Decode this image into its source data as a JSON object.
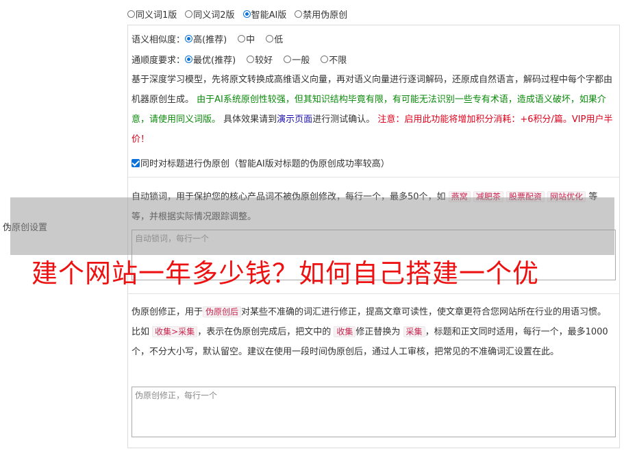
{
  "mode": {
    "options": [
      "同义词1版",
      "同义词2版",
      "智能AI版",
      "禁用伪原创"
    ],
    "selected": "智能AI版"
  },
  "side_label": "伪原创设置",
  "similarity": {
    "label": "语义相似度：",
    "options": [
      "高(推荐)",
      "中",
      "低"
    ],
    "selected": "高(推荐)"
  },
  "fluency": {
    "label": "通顺度要求：",
    "options": [
      "最优(推荐)",
      "较好",
      "一般",
      "不限"
    ],
    "selected": "最优(推荐)"
  },
  "description": {
    "normal1": "基于深度学习模型，先将原文转换成高维语义向量，再对语义向量进行逐词解码，还原成自然语言，解码过程中每个字都由机器原创生成。",
    "green": "由于AI系统原创性较强，但其知识结构毕竟有限，有可能无法识别一些专有术语，造成语义破坏，如果介意，请使用同义词版。",
    "normal2": "具体效果请到",
    "link": "演示页面",
    "normal3": "进行测试确认。",
    "red": "注意：启用此功能将增加积分消耗：+6积分/篇。VIP用户半价！"
  },
  "title_checkbox": {
    "checked": true,
    "label": "同时对标题进行伪原创（智能AI版对标题的伪原创成功率较高）"
  },
  "lock_words": {
    "text1": "自动锁词，用于保护您的核心产品词不被伪原创修改，每行一个，最多50个，如",
    "examples": [
      "燕窝",
      "减肥茶",
      "股票配资",
      "网站优化"
    ],
    "text2": "等等，并根据实际情况跟踪调整。",
    "placeholder": "自动锁词，每行一个"
  },
  "correction": {
    "text1": "伪原创修正，用于",
    "tag1": "伪原创后",
    "text2": "对某些不准确的词汇进行修正，提高文章可读性，使文章更符合您网站所在行业的用语习惯。比如",
    "tag2": "收集>采集",
    "text3": "，表示在伪原创完成后，把文中的",
    "tag3": "收集",
    "text4": "修正替换为",
    "tag4": "采集",
    "text5": "，标题和正文同时适用，每行一个，最多1000个，不分大小写，默认留空。建议在使用一段时间伪原创后，通过人工审核，把常见的不准确词汇设置在此。",
    "placeholder": "伪原创修正，每行一个"
  },
  "overlay_title": "建个网站一年多少钱？如何自己搭建一个优"
}
